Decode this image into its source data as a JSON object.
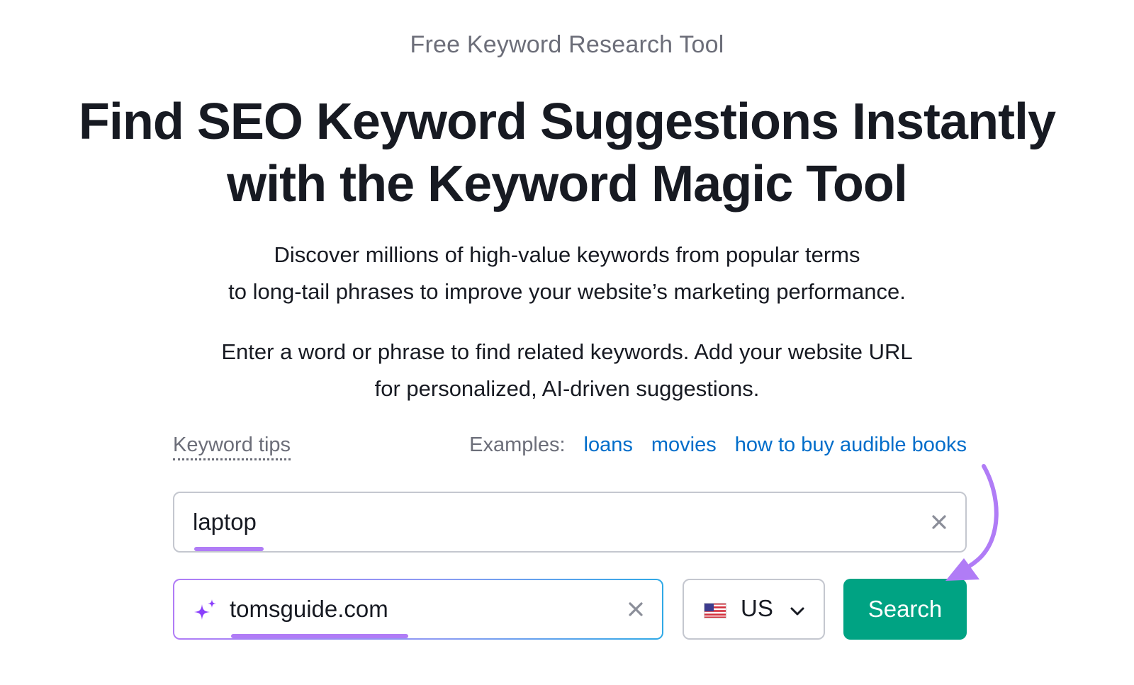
{
  "eyebrow": "Free Keyword Research Tool",
  "headline": {
    "line1": "Find SEO Keyword Suggestions Instantly",
    "line2": "with the Keyword Magic Tool"
  },
  "description": {
    "line1": "Discover millions of high-value keywords from popular terms",
    "line2": "to long-tail phrases to improve your website’s marketing performance."
  },
  "instructions": {
    "line1": "Enter a word or phrase to find related keywords. Add your website URL",
    "line2": "for personalized, AI-driven suggestions."
  },
  "tips": {
    "label": "Keyword tips",
    "examples_label": "Examples:",
    "examples": [
      "loans",
      "movies",
      "how to buy audible books"
    ]
  },
  "keyword_field": {
    "value": "laptop",
    "clear_icon": "close-icon"
  },
  "domain_field": {
    "value": "tomsguide.com",
    "icon": "sparkle-icon",
    "clear_icon": "close-icon"
  },
  "country_select": {
    "selected": "US",
    "flag_icon": "us-flag-icon",
    "chevron_icon": "chevron-down-icon"
  },
  "search_button": {
    "label": "Search"
  },
  "colors": {
    "accent_green": "#00a383",
    "link_blue": "#006dca",
    "highlight_purple": "#b07cf6",
    "text_dark": "#171a22",
    "text_muted": "#6c6e79"
  }
}
